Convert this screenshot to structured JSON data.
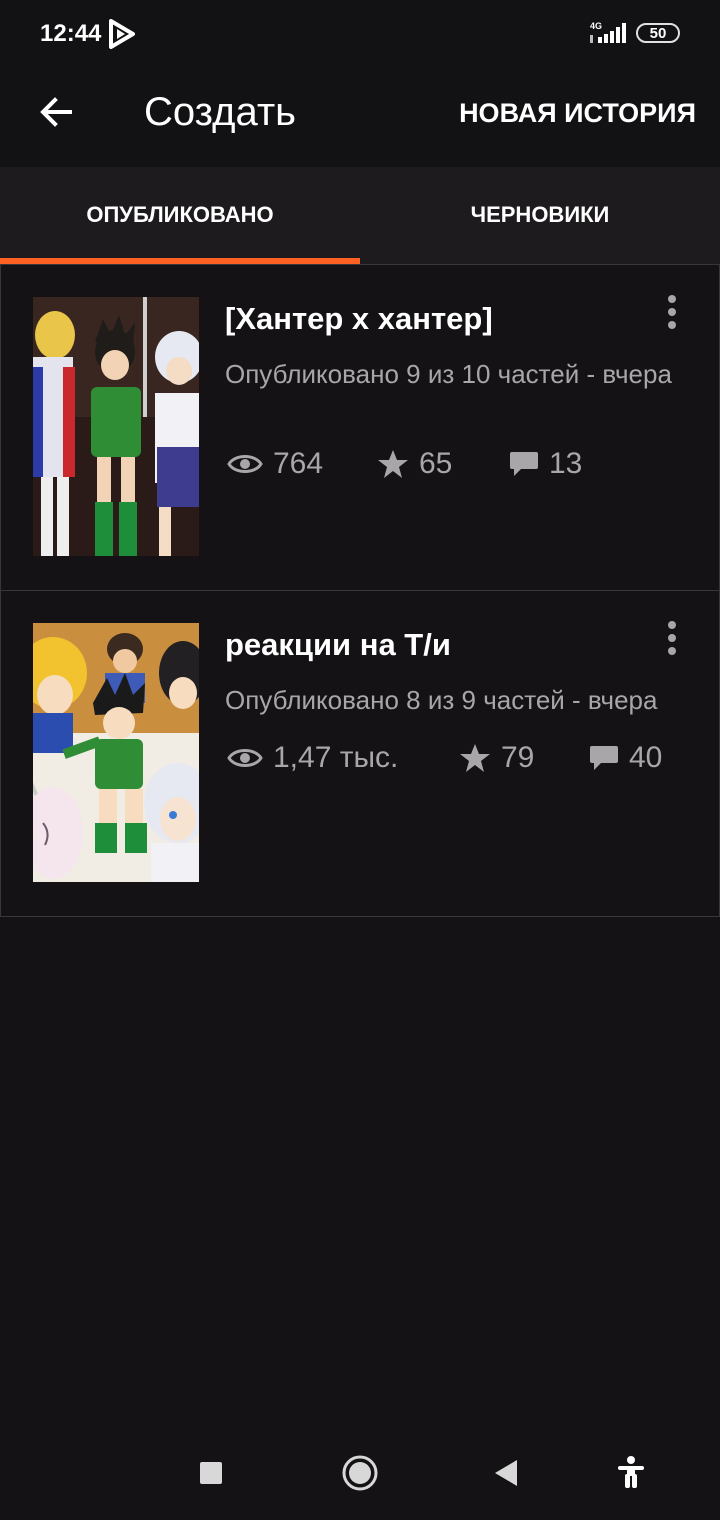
{
  "status_bar": {
    "time": "12:44",
    "network": "4G",
    "battery": "50"
  },
  "app_bar": {
    "back_icon": "arrow-left-icon",
    "title": "Создать",
    "new_story_label": "НОВАЯ ИСТОРИЯ"
  },
  "tabs": [
    {
      "label": "ОПУБЛИКОВАНО",
      "active": true
    },
    {
      "label": "ЧЕРНОВИКИ",
      "active": false
    }
  ],
  "stories": [
    {
      "title": "[Хантер х хантер]",
      "meta": "Опубликовано 9 из 10 частей - вчера",
      "views": "764",
      "votes": "65",
      "comments": "13"
    },
    {
      "title": "реакции на Т/и",
      "meta": "Опубликовано 8 из 9 частей - вчера",
      "views": "1,47 тыс.",
      "votes": "79",
      "comments": "40"
    }
  ],
  "colors": {
    "background": "#141215",
    "accent": "#ff6122",
    "secondary_text": "#a8a6a9"
  },
  "icons": {
    "views": "eye-icon",
    "votes": "star-icon",
    "comments": "comment-icon",
    "more": "more-vertical-icon"
  },
  "nav_bar": [
    "square-recents-icon",
    "circle-home-icon",
    "triangle-back-icon",
    "accessibility-icon"
  ]
}
